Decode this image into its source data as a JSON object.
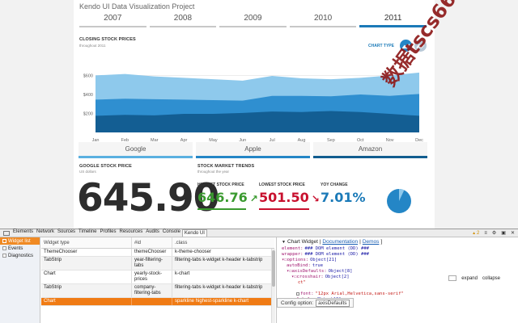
{
  "dashboard": {
    "project_title": "Kendo UI Data Visualization Project",
    "year_tabs": [
      {
        "label": "2007",
        "active": false
      },
      {
        "label": "2008",
        "active": false
      },
      {
        "label": "2009",
        "active": false
      },
      {
        "label": "2010",
        "active": false
      },
      {
        "label": "2011",
        "active": true
      }
    ],
    "closing_title": "CLOSING STOCK PRICES",
    "closing_subtitle": "throughout 2011",
    "chart_type_label": "CHART TYPE",
    "chart_type_buttons": [
      {
        "icon": "area-chart-icon",
        "active": true,
        "color": "#2486c6"
      },
      {
        "icon": "line-chart-icon",
        "active": false,
        "color": "#b8c8d6"
      }
    ],
    "stock_tabs": [
      "Google",
      "Apple",
      "Amazon"
    ],
    "google_title": "GOOGLE STOCK PRICE",
    "google_subtitle": "US dollars",
    "big_price": "645.90",
    "trends_title": "STOCK MARKET TRENDS",
    "trends_subtitle": "throughout the year",
    "highest_label": "HIGHEST STOCK PRICE",
    "highest_value": "646.76",
    "highest_arrow": "↗",
    "lowest_label": "LOWEST STOCK PRICE",
    "lowest_value": "501.50",
    "lowest_arrow": "↘",
    "yoy_label": "YOY CHANGE",
    "yoy_value": "7.01%",
    "yoy_fraction": 0.0701,
    "colors": {
      "accent": "#1b7ab8",
      "green": "#3a9a2f",
      "red": "#c8102e",
      "blue_value": "#1b7ab8"
    },
    "watermark_text": "数据tscs66"
  },
  "chart_data": {
    "type": "area",
    "title": "CLOSING STOCK PRICES",
    "subtitle": "throughout 2011",
    "categories": [
      "Jan",
      "Feb",
      "Mar",
      "Apr",
      "May",
      "Jun",
      "Jul",
      "Aug",
      "Sep",
      "Oct",
      "Nov",
      "Dec"
    ],
    "y_ticks": [
      "$200",
      "$400",
      "$600"
    ],
    "ylim": [
      0,
      680
    ],
    "grid": true,
    "series": [
      {
        "name": "Google",
        "color": "#8ec9ec",
        "values": [
          600,
          615,
          590,
          575,
          560,
          545,
          595,
          570,
          560,
          575,
          600,
          630
        ]
      },
      {
        "name": "Apple",
        "color": "#2f8fd0",
        "values": [
          345,
          355,
          350,
          345,
          340,
          335,
          385,
          385,
          380,
          400,
          385,
          405
        ]
      },
      {
        "name": "Amazon",
        "color": "#135e93",
        "values": [
          175,
          185,
          180,
          195,
          195,
          205,
          220,
          215,
          225,
          215,
          195,
          175
        ]
      }
    ]
  },
  "devtools": {
    "tabs": [
      "Elements",
      "Network",
      "Sources",
      "Timeline",
      "Profiles",
      "Resources",
      "Audits",
      "Console",
      "Kendo UI"
    ],
    "active_tab": "Kendo UI",
    "warnings": "2",
    "right_icons": [
      "console-icon",
      "settings-icon",
      "dock-icon",
      "close-icon"
    ],
    "sidebar": [
      {
        "label": "Widget list",
        "active": true
      },
      {
        "label": "Events",
        "active": false
      },
      {
        "label": "Diagnostics",
        "active": false
      }
    ],
    "columns": [
      "Widget type",
      "#id",
      ".class"
    ],
    "rows": [
      {
        "type": "ThemeChooser",
        "id": "themeChooser",
        "cls": "k-theme-chooser",
        "state": "normal"
      },
      {
        "type": "TabStrip",
        "id": "year-filtering-tabs",
        "cls": "filtering-tabs k-widget k-header k-tabstrip",
        "state": "alt"
      },
      {
        "type": "Chart",
        "id": "yearly-stock-prices",
        "cls": "k-chart",
        "state": "normal"
      },
      {
        "type": "TabStrip",
        "id": "company-filtering-tabs",
        "cls": "filtering-tabs k-widget k-header k-tabstrip",
        "state": "alt"
      },
      {
        "type": "Chart",
        "id": "",
        "cls": "sparkline highest-sparkline k-chart",
        "state": "selected"
      }
    ],
    "inspector": {
      "title_prefix": "Chart Widget |",
      "doc_link": "Documentation",
      "sep": "|",
      "demo_link": "Demos",
      "trail": "]",
      "lines": [
        {
          "indent": 0,
          "key": "element:",
          "val": "### DOM element (DD) ###",
          "valType": "v",
          "check": false
        },
        {
          "indent": 0,
          "key": "wrapper:",
          "val": "### DOM element (DD) ###",
          "valType": "v",
          "check": false
        },
        {
          "indent": 0,
          "key": "▾☐options:",
          "val": "Object[21]",
          "valType": "v",
          "check": false
        },
        {
          "indent": 1,
          "key": "autoBind:",
          "val": "true",
          "valType": "v",
          "check": false
        },
        {
          "indent": 1,
          "key": "▾☐axisDefaults:",
          "val": "Object[8]",
          "valType": "v",
          "check": false
        },
        {
          "indent": 2,
          "key": "▾☐crosshair:",
          "val": "Object[2]",
          "valType": "v",
          "check": false
        },
        {
          "indent": 3,
          "key": "",
          "val": "ct\"",
          "valType": "s",
          "check": false
        },
        {
          "indent": 3,
          "key": "",
          "val": "",
          "valType": "v",
          "check": false
        },
        {
          "indent": 3,
          "key": "font:",
          "val": "\"12px Arial,Helvetica,sans-serif\"",
          "valType": "s",
          "check": true
        },
        {
          "indent": 2,
          "key": "▾☐labels:",
          "val": "Object[2]",
          "valType": "v",
          "check": false
        }
      ],
      "expand_label": "expand",
      "collapse_label": "collapse",
      "config_tip_label": "Config option:",
      "config_tip_value": "axisDefaults"
    }
  }
}
